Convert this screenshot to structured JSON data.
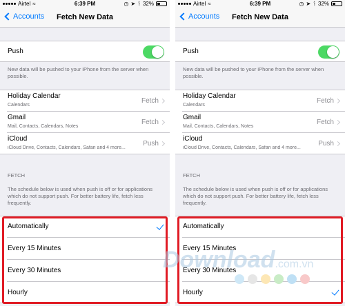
{
  "status": {
    "carrier": "Airtel",
    "time": "6:39 PM",
    "battery": "32%"
  },
  "nav": {
    "back_label": "Accounts",
    "title": "Fetch New Data"
  },
  "push": {
    "label": "Push",
    "on": true,
    "footnote": "New data will be pushed to your iPhone from the server when possible."
  },
  "accounts": [
    {
      "name": "Holiday Calendar",
      "sub": "Calendars",
      "value": "Fetch"
    },
    {
      "name": "Gmail",
      "sub": "Mail, Contacts, Calendars, Notes",
      "value": "Fetch"
    },
    {
      "name": "iCloud",
      "sub": "iCloud Drive, Contacts, Calendars, Safari and 4 more...",
      "value": "Push"
    }
  ],
  "fetch": {
    "header": "FETCH",
    "footnote": "The schedule below is used when push is off or for applications which do not support push. For better battery life, fetch less frequently.",
    "options": [
      "Automatically",
      "Every 15 Minutes",
      "Every 30 Minutes",
      "Hourly"
    ]
  },
  "screens": [
    {
      "selected_option": "Automatically"
    },
    {
      "selected_option": "Hourly"
    }
  ],
  "watermark": {
    "text": "Download",
    "suffix": ".com.vn"
  },
  "colors": {
    "accent": "#007aff",
    "toggle_on": "#4cd964",
    "highlight": "#e01b24",
    "dots": [
      "#cfe8f7",
      "#e6e6e6",
      "#fde7b5",
      "#c9ecc6",
      "#bfe0f5",
      "#f8c9c9"
    ]
  }
}
